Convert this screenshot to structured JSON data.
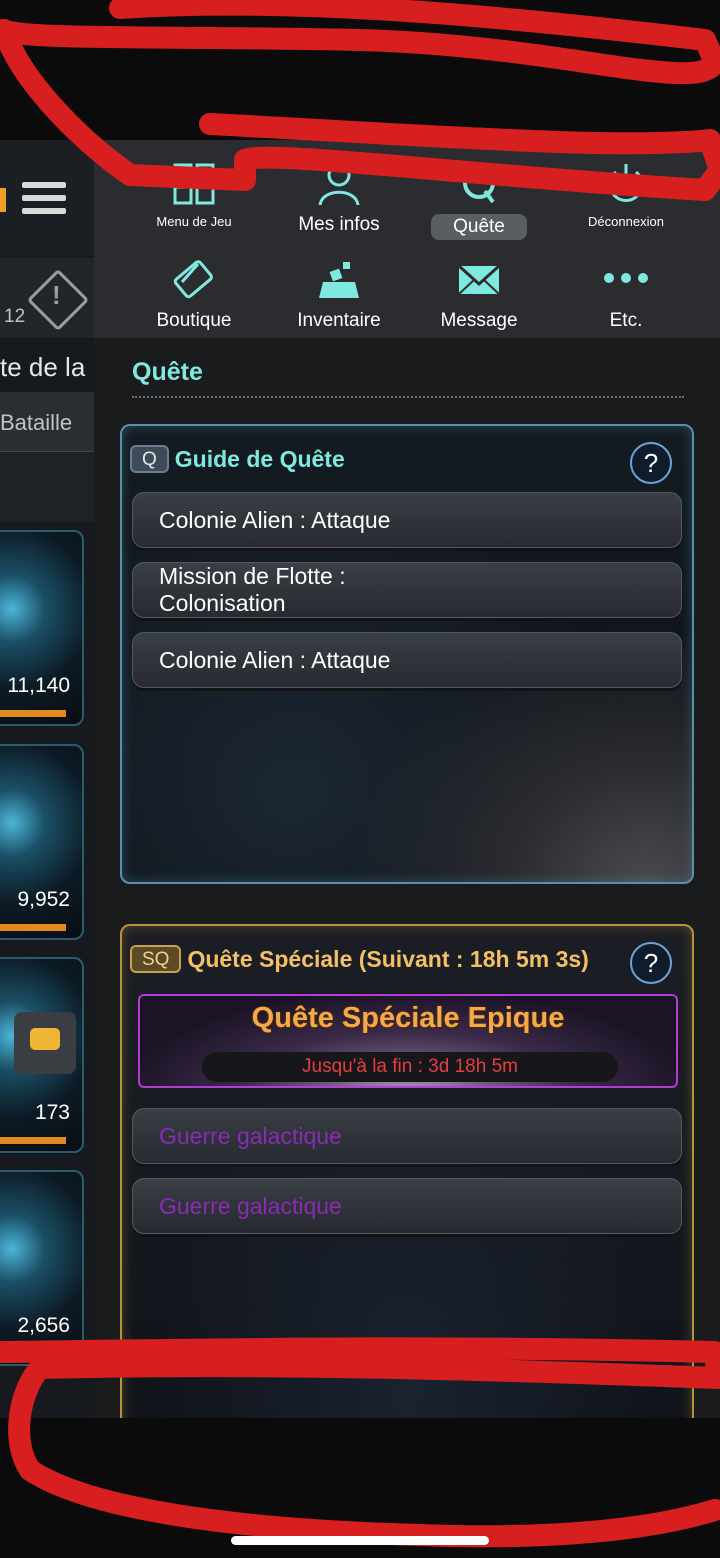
{
  "background_game": {
    "badge_count": "12",
    "title_fragment": "te de la",
    "tab_label": "Bataille",
    "card_values": [
      "11,140",
      "9,952",
      "173",
      "2,656"
    ]
  },
  "nav": {
    "items": [
      {
        "label": "Menu de Jeu",
        "icon": "grid-icon"
      },
      {
        "label": "Mes infos",
        "icon": "user-icon"
      },
      {
        "label": "Quête",
        "icon": "quest-icon",
        "active": true
      },
      {
        "label": "Déconnexion",
        "icon": "power-icon"
      },
      {
        "label": "Boutique",
        "icon": "shop-card-icon"
      },
      {
        "label": "Inventaire",
        "icon": "inventory-icon"
      },
      {
        "label": "Message",
        "icon": "envelope-icon"
      },
      {
        "label": "Etc.",
        "icon": "more-dots-icon"
      }
    ]
  },
  "page": {
    "section_title": "Quête"
  },
  "guide": {
    "badge": "Q",
    "title": "Guide de Quête",
    "help": "?",
    "quests": [
      {
        "line1": "Colonie Alien : Attaque",
        "line2": ""
      },
      {
        "line1": "Mission de Flotte :",
        "line2": "Colonisation"
      },
      {
        "line1": "Colonie Alien : Attaque",
        "line2": ""
      }
    ]
  },
  "special": {
    "badge": "SQ",
    "title": "Quête Spéciale (Suivant : 18h 5m 3s)",
    "help": "?",
    "epic_title": "Quête Spéciale Epique",
    "epic_timer": "Jusqu'à la fin : 3d 18h 5m",
    "quests": [
      "Guerre galactique",
      "Guerre galactique"
    ]
  },
  "colors": {
    "accent_cyan": "#7fe9e0",
    "accent_gold": "#f3c064",
    "epic_orange": "#f4a94a",
    "timer_red": "#e63e3e",
    "quest_purple": "#8a2bb4",
    "scribble_red": "#d81f1f"
  }
}
